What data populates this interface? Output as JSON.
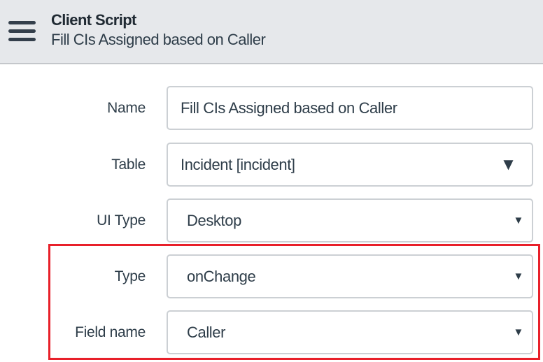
{
  "header": {
    "title": "Client Script",
    "subtitle": "Fill CIs Assigned based on Caller",
    "menu_icon": "hamburger-icon"
  },
  "form": {
    "name": {
      "label": "Name",
      "value": "Fill CIs Assigned based on Caller"
    },
    "table": {
      "label": "Table",
      "value": "Incident [incident]"
    },
    "ui_type": {
      "label": "UI Type",
      "value": "Desktop"
    },
    "type": {
      "label": "Type",
      "value": "onChange"
    },
    "field_name": {
      "label": "Field name",
      "value": "Caller"
    }
  },
  "highlight_color": "#e8202a"
}
